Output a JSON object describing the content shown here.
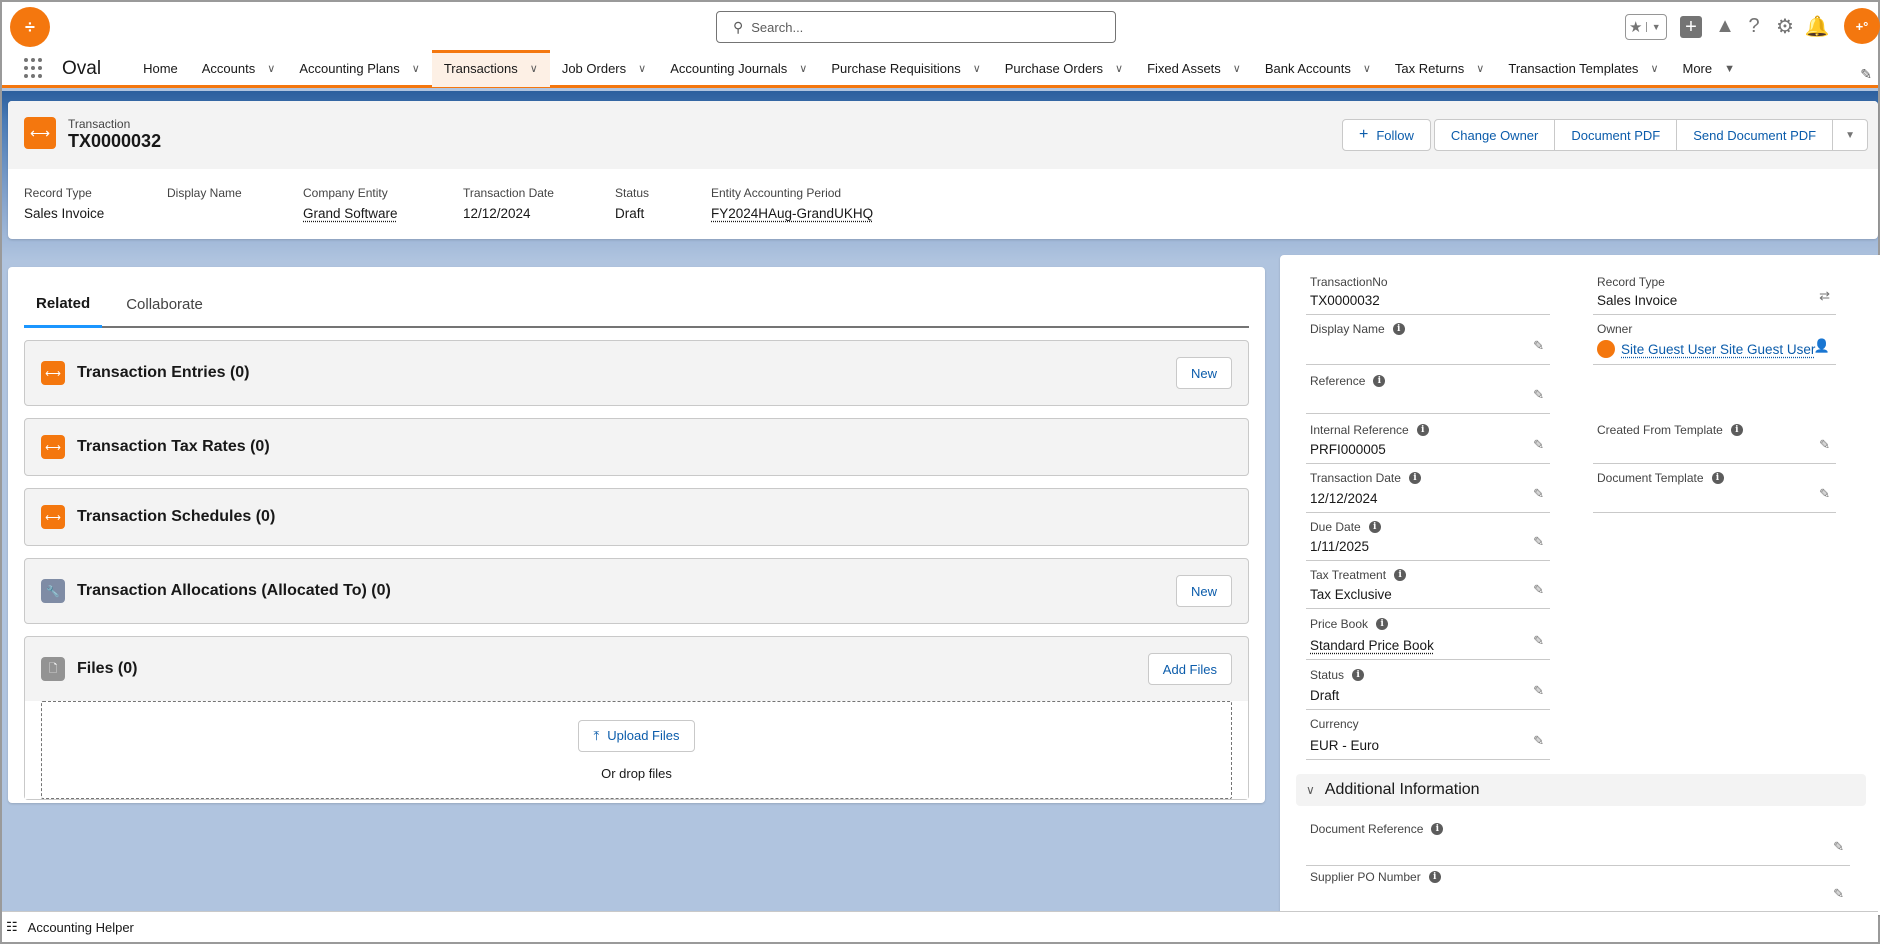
{
  "header": {
    "search_placeholder": "Search...",
    "logo_glyph": "÷",
    "icons": [
      "favorites-star-icon",
      "favorites-dropdown-icon",
      "global-create-icon",
      "trailhead-icon",
      "help-icon",
      "setup-gear-icon",
      "notifications-bell-icon",
      "user-avatar"
    ]
  },
  "nav": {
    "app_name": "Oval",
    "items": [
      {
        "label": "Home",
        "dropdown": false
      },
      {
        "label": "Accounts",
        "dropdown": true
      },
      {
        "label": "Accounting Plans",
        "dropdown": true
      },
      {
        "label": "Transactions",
        "dropdown": true,
        "active": true
      },
      {
        "label": "Job Orders",
        "dropdown": true
      },
      {
        "label": "Accounting Journals",
        "dropdown": true
      },
      {
        "label": "Purchase Requisitions",
        "dropdown": true
      },
      {
        "label": "Purchase Orders",
        "dropdown": true
      },
      {
        "label": "Fixed Assets",
        "dropdown": true
      },
      {
        "label": "Bank Accounts",
        "dropdown": true
      },
      {
        "label": "Tax Returns",
        "dropdown": true
      },
      {
        "label": "Transaction Templates",
        "dropdown": true
      },
      {
        "label": "More",
        "dropdown": true
      }
    ]
  },
  "record": {
    "object_type": "Transaction",
    "name": "TX0000032",
    "actions": {
      "follow": "Follow",
      "change_owner": "Change Owner",
      "document_pdf": "Document PDF",
      "send_document_pdf": "Send Document PDF"
    },
    "highlights": [
      {
        "label": "Record Type",
        "value": "Sales Invoice",
        "link": false
      },
      {
        "label": "Display Name",
        "value": "",
        "link": false
      },
      {
        "label": "Company Entity",
        "value": "Grand Software",
        "link": true
      },
      {
        "label": "Transaction Date",
        "value": "12/12/2024",
        "link": false
      },
      {
        "label": "Status",
        "value": "Draft",
        "link": false
      },
      {
        "label": "Entity Accounting Period",
        "value": "FY2024HAug-GrandUKHQ",
        "link": true
      }
    ]
  },
  "related": {
    "tabs": [
      {
        "label": "Related",
        "active": true
      },
      {
        "label": "Collaborate",
        "active": false
      }
    ],
    "lists": [
      {
        "title": "Transaction Entries (0)",
        "icon": "transaction-icon",
        "button": "New"
      },
      {
        "title": "Transaction Tax Rates (0)",
        "icon": "transaction-icon",
        "button": null
      },
      {
        "title": "Transaction Schedules (0)",
        "icon": "transaction-icon",
        "button": null
      },
      {
        "title": "Transaction Allocations (Allocated To) (0)",
        "icon": "wrench-icon",
        "button": "New"
      }
    ],
    "files": {
      "title": "Files (0)",
      "add_button": "Add Files",
      "upload_button": "Upload Files",
      "drop_text": "Or drop files"
    }
  },
  "details": {
    "left": [
      {
        "label": "TransactionNo",
        "value": "TX0000032",
        "info": false,
        "editable": false
      },
      {
        "label": "Display Name",
        "value": "",
        "info": true,
        "editable": true
      },
      {
        "label": "Reference",
        "value": "",
        "info": true,
        "editable": true
      },
      {
        "label": "Internal Reference",
        "value": "PRFI000005",
        "info": true,
        "editable": true
      },
      {
        "label": "Transaction Date",
        "value": "12/12/2024",
        "info": true,
        "editable": true
      },
      {
        "label": "Due Date",
        "value": "1/11/2025",
        "info": true,
        "editable": true
      },
      {
        "label": "Tax Treatment",
        "value": "Tax Exclusive",
        "info": true,
        "editable": true
      },
      {
        "label": "Price Book",
        "value": "Standard Price Book",
        "info": true,
        "editable": true,
        "link": true
      },
      {
        "label": "Status",
        "value": "Draft",
        "info": true,
        "editable": true
      },
      {
        "label": "Currency",
        "value": "EUR - Euro",
        "info": false,
        "editable": true
      }
    ],
    "right": [
      {
        "label": "Record Type",
        "value": "Sales Invoice",
        "action": "change-record-type-icon"
      },
      {
        "label": "Owner",
        "value": "Site Guest User Site Guest User",
        "link": true,
        "action": "change-owner-icon"
      },
      {
        "label": "Created From Template",
        "value": "",
        "info": true,
        "editable": true
      },
      {
        "label": "Document Template",
        "value": "",
        "info": true,
        "editable": true
      }
    ],
    "additional_section": {
      "title": "Additional Information",
      "fields": [
        {
          "label": "Document Reference",
          "value": "",
          "info": true,
          "editable": true
        },
        {
          "label": "Supplier PO Number",
          "value": "",
          "info": true,
          "editable": true
        }
      ]
    }
  },
  "utility_bar": {
    "label": "Accounting Helper"
  },
  "colors": {
    "brand": "#f4770e",
    "link": "#0b5cab",
    "tab_active": "#1b96ff",
    "background": "#b0c4df"
  }
}
